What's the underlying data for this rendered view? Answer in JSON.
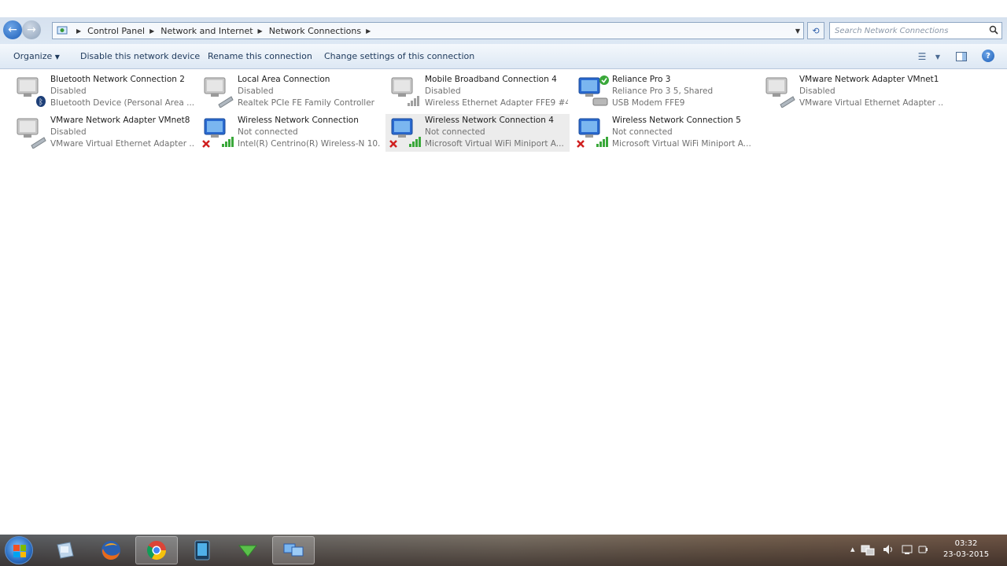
{
  "address_bar": {
    "crumbs": [
      "Control Panel",
      "Network and Internet",
      "Network Connections"
    ],
    "search_placeholder": "Search Network Connections"
  },
  "toolbar": {
    "organize": "Organize",
    "disable": "Disable this network device",
    "rename": "Rename this connection",
    "change_settings": "Change settings of this connection"
  },
  "connections": [
    {
      "name": "Bluetooth Network Connection 2",
      "status": "Disabled",
      "device": "Bluetooth Device (Personal Area ..."
    },
    {
      "name": "Local Area Connection",
      "status": "Disabled",
      "device": "Realtek PCIe FE Family Controller"
    },
    {
      "name": "Mobile Broadband Connection 4",
      "status": "Disabled",
      "device": "Wireless Ethernet Adapter FFE9 #4"
    },
    {
      "name": "Reliance Pro 3",
      "status": "Reliance Pro 3  5, Shared",
      "device": "USB Modem FFE9"
    },
    {
      "name": "VMware Network Adapter VMnet1",
      "status": "Disabled",
      "device": "VMware Virtual Ethernet Adapter ..."
    },
    {
      "name": "VMware Network Adapter VMnet8",
      "status": "Disabled",
      "device": "VMware Virtual Ethernet Adapter ..."
    },
    {
      "name": "Wireless Network Connection",
      "status": "Not connected",
      "device": "Intel(R) Centrino(R) Wireless-N 10..."
    },
    {
      "name": "Wireless Network Connection 4",
      "status": "Not connected",
      "device": "Microsoft Virtual WiFi Miniport A..."
    },
    {
      "name": "Wireless Network Connection 5",
      "status": "Not connected",
      "device": "Microsoft Virtual WiFi Miniport A..."
    }
  ],
  "taskbar": {
    "time": "03:32",
    "date": "23-03-2015"
  }
}
